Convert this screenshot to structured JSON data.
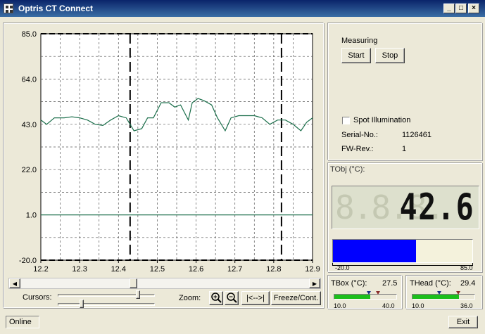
{
  "window": {
    "title": "Optris CT Connect",
    "min_label": "_",
    "max_label": "□",
    "close_label": "×"
  },
  "chart_data": {
    "type": "line",
    "title": "",
    "xlabel": "",
    "ylabel": "",
    "xlim": [
      12.2,
      12.9
    ],
    "ylim": [
      -20.0,
      85.0
    ],
    "xticks": [
      "12.2",
      "12.3",
      "12.4",
      "12.5",
      "12.6",
      "12.7",
      "12.8",
      "12.9"
    ],
    "yticks": [
      "85.0",
      "64.0",
      "43.0",
      "22.0",
      "1.0",
      "-20.0"
    ],
    "grid": true,
    "cursors_x": [
      12.43,
      12.82
    ],
    "threshold_y": 1.0,
    "series": [
      {
        "color": "#1a6e4a",
        "x": [
          12.2,
          12.215,
          12.235,
          12.26,
          12.28,
          12.3,
          12.32,
          12.34,
          12.36,
          12.38,
          12.4,
          12.42,
          12.44,
          12.46,
          12.475,
          12.49,
          12.51,
          12.53,
          12.545,
          12.56,
          12.58,
          12.59,
          12.605,
          12.62,
          12.64,
          12.655,
          12.675,
          12.69,
          12.71,
          12.73,
          12.75,
          12.77,
          12.79,
          12.81,
          12.83,
          12.85,
          12.87,
          12.885,
          12.9
        ],
        "y": [
          45,
          43,
          46,
          46,
          46.5,
          46,
          45,
          43,
          42.5,
          45,
          47,
          46,
          40,
          41,
          46,
          46,
          53,
          53,
          51,
          52,
          45,
          53,
          55,
          54,
          52,
          46,
          40,
          46,
          47,
          47,
          47,
          46,
          43,
          45,
          45,
          43,
          40,
          44,
          46
        ]
      }
    ]
  },
  "scrollbar": {
    "left_arrow": "◀",
    "right_arrow": "▶"
  },
  "cursors": {
    "label": "Cursors:"
  },
  "zoom": {
    "label": "Zoom:",
    "zoom_in_icon": "zoom-in-icon",
    "zoom_out_icon": "zoom-out-icon",
    "fit_label": "|<-->|",
    "freeze_label": "Freeze/Cont."
  },
  "measuring": {
    "title": "Measuring",
    "start_label": "Start",
    "stop_label": "Stop"
  },
  "device": {
    "spot_label": "Spot Illumination",
    "spot_checked": false,
    "serial_label": "Serial-No.:",
    "serial_value": "1126461",
    "fw_label": "FW-Rev.:",
    "fw_value": "1"
  },
  "tobj": {
    "title": "TObj (°C):",
    "value": "42.6",
    "ghost": "8.8.8.",
    "bar_fraction": 0.596,
    "scale_min": "-20.0",
    "scale_max": "85.0",
    "bar_color": "#0000ff",
    "bar_bg": "#f4f2dc"
  },
  "tbox": {
    "title": "TBox (°C):",
    "value": "27.5",
    "scale_min": "10.0",
    "scale_max": "40.0",
    "fill_fraction": 0.58
  },
  "thead": {
    "title": "THead (°C):",
    "value": "29.4",
    "scale_min": "10.0",
    "scale_max": "36.0",
    "fill_fraction": 0.75
  },
  "status": {
    "text": "Online",
    "exit_label": "Exit"
  }
}
